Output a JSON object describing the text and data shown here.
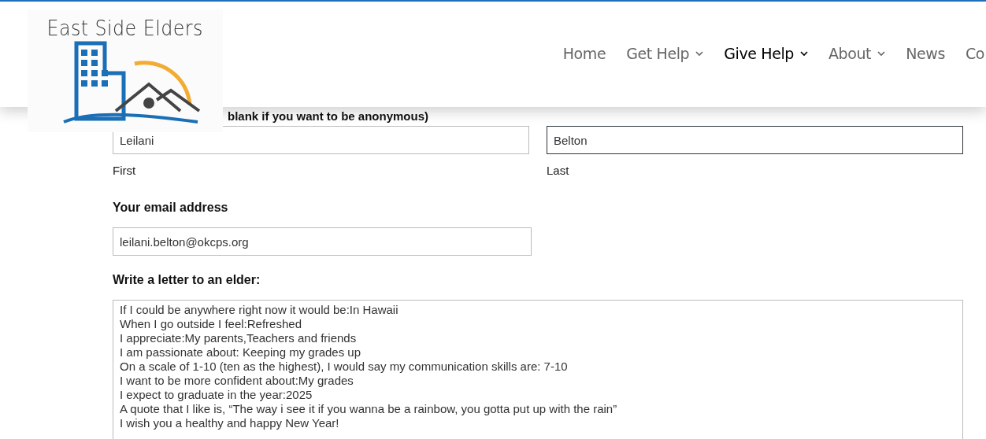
{
  "header": {
    "logo": {
      "title": "East Side Elders"
    },
    "nav": [
      {
        "label": "Home",
        "selected": false,
        "dropdown": false
      },
      {
        "label": "Get Help",
        "selected": false,
        "dropdown": true
      },
      {
        "label": "Give Help",
        "selected": true,
        "dropdown": true
      },
      {
        "label": "About",
        "selected": false,
        "dropdown": true
      },
      {
        "label": "News",
        "selected": false,
        "dropdown": false
      },
      {
        "label": "Co",
        "selected": false,
        "dropdown": false
      }
    ]
  },
  "form": {
    "name_label": "blank if you want to be anonymous)",
    "first": {
      "value": "Leilani",
      "sublabel": "First",
      "focused": false
    },
    "last": {
      "value": "Belton",
      "sublabel": "Last",
      "focused": true
    },
    "email": {
      "label": "Your email address",
      "value": "leilani.belton@okcps.org"
    },
    "letter": {
      "label": "Write a letter to an elder:",
      "lines": [
        "If I could be anywhere right now it would be:In Hawaii",
        "When I go outside I feel:Refreshed",
        "I appreciate:My parents,Teachers and friends",
        "I am passionate about: Keeping my grades up",
        "On a scale of 1-10 (ten as the highest), I would say my communication skills are: 7-10",
        "I want to be more confident about:My grades",
        "I expect to graduate in the year:2025",
        "A quote that I like is, “The way i see it if you wanna be a rainbow, you gotta put up with the rain”",
        "I wish you a healthy and happy New Year!"
      ]
    }
  }
}
